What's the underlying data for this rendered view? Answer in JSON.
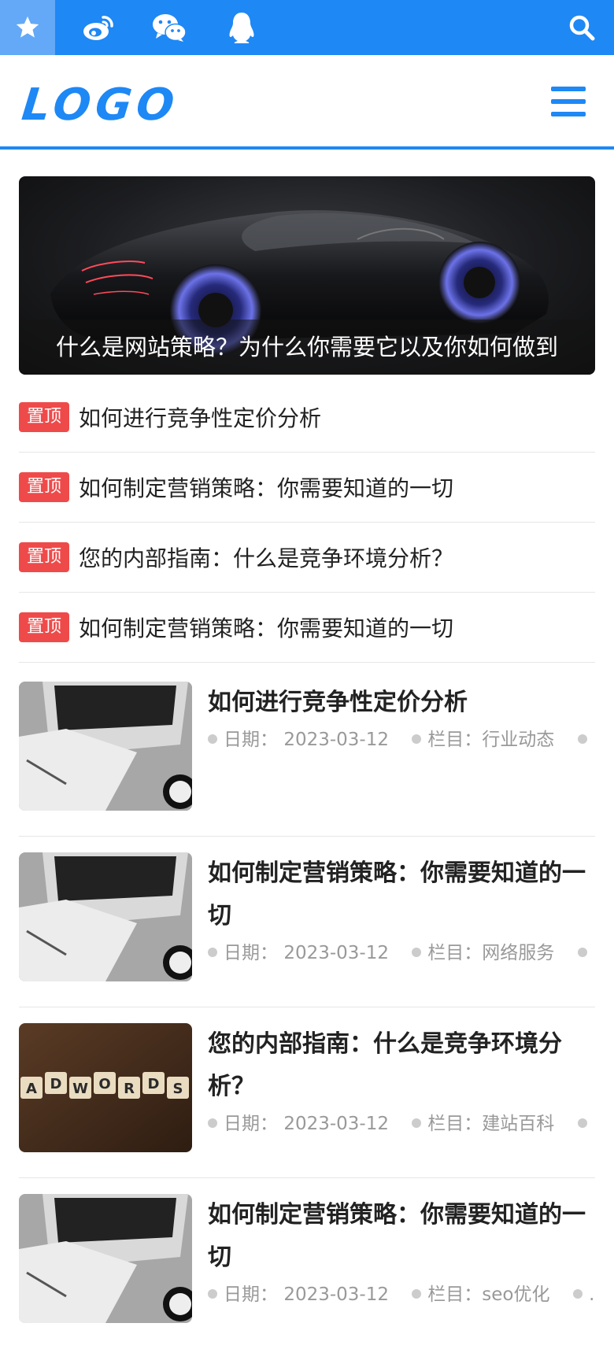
{
  "topbar": {
    "icons": [
      "star-icon",
      "weibo-icon",
      "wechat-icon",
      "qq-icon",
      "search-icon"
    ],
    "accent": "#1e88f5",
    "star_bg": "#63a9f7"
  },
  "header": {
    "logo": "LOGO",
    "menu_icon": "hamburger-menu-icon"
  },
  "banner": {
    "caption": "什么是网站策略？为什么你需要它以及你如何做到"
  },
  "pinned": {
    "badge_label": "置顶",
    "items": [
      {
        "title": "如何进行竞争性定价分析"
      },
      {
        "title": "如何制定营销策略：你需要知道的一切"
      },
      {
        "title": "您的内部指南：什么是竞争环境分析？"
      },
      {
        "title": "如何制定营销策略：你需要知道的一切"
      }
    ]
  },
  "articles": {
    "date_label": "日期：",
    "category_label": "栏目：",
    "more": "…",
    "items": [
      {
        "title": "如何进行竞争性定价分析",
        "date": "2023-03-12",
        "category": "行业动态",
        "thumb": "laptop"
      },
      {
        "title": "如何制定营销策略：你需要知道的一切",
        "date": "2023-03-12",
        "category": "网络服务",
        "thumb": "laptop"
      },
      {
        "title": "您的内部指南：什么是竞争环境分析？",
        "date": "2023-03-12",
        "category": "建站百科",
        "thumb": "adwords"
      },
      {
        "title": "如何制定营销策略：你需要知道的一切",
        "date": "2023-03-12",
        "category": "seo优化",
        "thumb": "laptop"
      }
    ]
  },
  "adwords_tiles": [
    "A",
    "D",
    "W",
    "O",
    "R",
    "D",
    "S"
  ],
  "colors": {
    "badge": "#ef4a4a",
    "divider": "#e6e6e6",
    "meta_text": "#999999"
  }
}
